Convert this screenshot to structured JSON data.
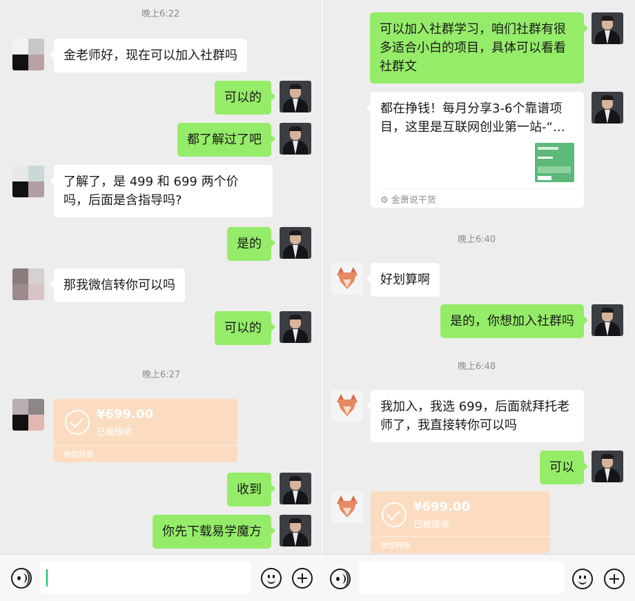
{
  "left": {
    "times": [
      "晚上6:22",
      "晚上6:27"
    ],
    "messages": {
      "m1": "金老师好，现在可以加入社群吗",
      "m2": "可以的",
      "m3": "都了解过了吧",
      "m4": "了解了，是 499 和 699 两个价吗，后面是含指导吗?",
      "m5": "是的",
      "m6": "那我微信转你可以吗",
      "m7": "可以的",
      "m9": "收到",
      "m10": "你先下载易学魔方"
    },
    "transfer": {
      "amount": "¥699.00",
      "status": "已被接收",
      "footer": "微信转账"
    }
  },
  "right": {
    "times": [
      "晚上6:40",
      "晚上6:48"
    ],
    "messages": {
      "r1": "可以加入社群学习，咱们社群有很多适合小白的项目，具体可以看看社群文",
      "r3": "好划算啊",
      "r4": "是的，你想加入社群吗",
      "r5": "我加入，我选 699，后面就拜托老师了，我直接转你可以吗",
      "r6": "可以"
    },
    "link_card": {
      "title": "都在挣钱！每月分享3-6个靠谱项目，这里是互联网创业第一站-“…",
      "source": "金萧说干货"
    },
    "transfer": {
      "amount": "¥699.00",
      "status": "已被接收",
      "footer": "微信转账"
    }
  },
  "colors": {
    "outgoing_bubble": "#95ec69",
    "incoming_bubble": "#ffffff",
    "transfer_card": "#fbdcc1",
    "chat_background": "#ededed"
  },
  "icons": {
    "voice": "voice-icon",
    "emoji": "emoji-icon",
    "more": "plus-icon"
  }
}
